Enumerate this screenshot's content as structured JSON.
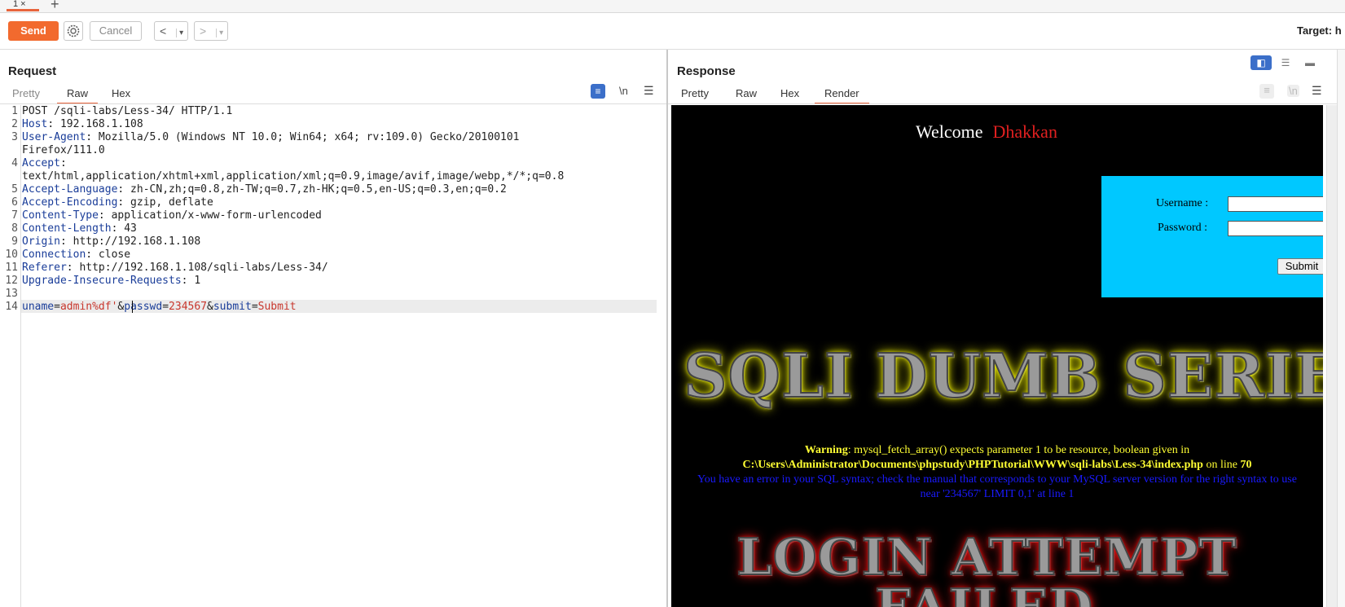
{
  "tabs": {
    "first": "1 ×",
    "add": "+"
  },
  "toolbar": {
    "send": "Send",
    "cancel": "Cancel",
    "back": "<",
    "forward": ">",
    "dropdown": "▾",
    "target": "Target: h"
  },
  "request": {
    "title": "Request",
    "tabs": [
      "Pretty",
      "Raw",
      "Hex"
    ],
    "active_tab": "Raw",
    "newline_toggle": "\\n",
    "menu": "☰",
    "line_numbers": [
      "1",
      "2",
      "3",
      "4",
      "5",
      "6",
      "7",
      "8",
      "9",
      "10",
      "11",
      "12",
      "13",
      "14"
    ],
    "request_line": "POST /sqli-labs/Less-34/ HTTP/1.1",
    "headers": [
      {
        "key": "Host",
        "value": ": 192.168.1.108"
      },
      {
        "key": "User-Agent",
        "value": ": Mozilla/5.0 (Windows NT 10.0; Win64; x64; rv:109.0) Gecko/20100101"
      },
      {
        "key": "",
        "value": "Firefox/111.0"
      },
      {
        "key": "Accept",
        "value": ":"
      },
      {
        "key": "",
        "value": "text/html,application/xhtml+xml,application/xml;q=0.9,image/avif,image/webp,*/*;q=0.8"
      },
      {
        "key": "Accept-Language",
        "value": ": zh-CN,zh;q=0.8,zh-TW;q=0.7,zh-HK;q=0.5,en-US;q=0.3,en;q=0.2"
      },
      {
        "key": "Accept-Encoding",
        "value": ": gzip, deflate"
      },
      {
        "key": "Content-Type",
        "value": ": application/x-www-form-urlencoded"
      },
      {
        "key": "Content-Length",
        "value": ": 43"
      },
      {
        "key": "Origin",
        "value": ": http://192.168.1.108"
      },
      {
        "key": "Connection",
        "value": ": close"
      },
      {
        "key": "Referer",
        "value": ": http://192.168.1.108/sqli-labs/Less-34/"
      },
      {
        "key": "Upgrade-Insecure-Requests",
        "value": ": 1"
      }
    ],
    "body": {
      "k1": "uname",
      "eq": "=",
      "v1": "admin%df'",
      "amp": "&",
      "k2": "passwd",
      "v2": "234567",
      "k3": "submit",
      "v3": "Submit"
    }
  },
  "response": {
    "title": "Response",
    "tabs": [
      "Pretty",
      "Raw",
      "Hex",
      "Render"
    ],
    "active_tab": "Render",
    "newline_toggle": "\\n",
    "menu": "☰",
    "render": {
      "welcome": "Welcome",
      "name": "Dhakkan",
      "username_label": "Username :",
      "password_label": "Password :",
      "submit": "Submit",
      "banner_top": "SQLI DUMB SERIES",
      "warning_label": "Warning",
      "warning_text": ": mysql_fetch_array() expects parameter 1 to be resource, boolean given in",
      "warning_path": "C:\\Users\\Administrator\\Documents\\phpstudy\\PHPTutorial\\WWW\\sqli-labs\\Less-34\\index.php",
      "warning_line_text": " on line ",
      "warning_line_no": "70",
      "sql_error": "You have an error in your SQL syntax; check the manual that corresponds to your MySQL server version for the right syntax to use near '234567' LIMIT 0,1' at line 1",
      "banner_login": "LOGIN ATTEMPT",
      "banner_failed": "FAILED"
    }
  },
  "colors": {
    "accent": "#f26a2e",
    "header_key": "#1a3d99",
    "param_value": "#c8372d",
    "login_box": "#00c8ff"
  }
}
